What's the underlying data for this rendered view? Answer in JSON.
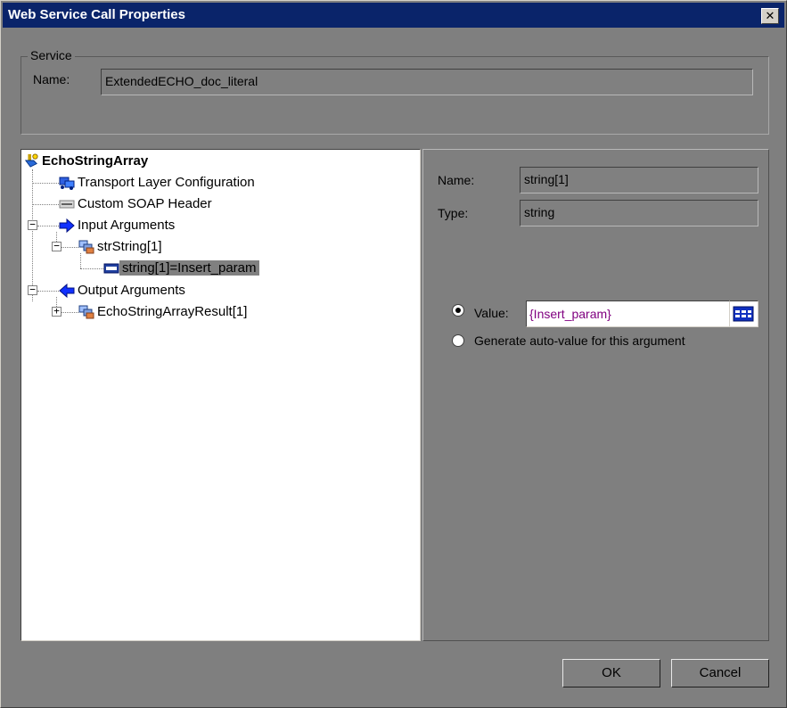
{
  "window": {
    "title": "Web Service Call Properties",
    "close_glyph": "✕"
  },
  "service": {
    "group_label": "Service",
    "name_label": "Name:",
    "name_value": "ExtendedECHO_doc_literal"
  },
  "tree": {
    "root": "EchoStringArray",
    "items": [
      {
        "label": "Transport Layer Configuration",
        "icon": "transport-icon"
      },
      {
        "label": "Custom SOAP Header",
        "icon": "soap-header-icon"
      },
      {
        "label": "Input Arguments",
        "icon": "input-arrow-icon",
        "expander": "−"
      },
      {
        "label": "strString[1]",
        "icon": "complex-type-icon",
        "expander": "−"
      },
      {
        "label": "string[1]=Insert_param",
        "icon": "string-type-icon",
        "selected": true
      },
      {
        "label": "Output Arguments",
        "icon": "output-arrow-icon",
        "expander": "−"
      },
      {
        "label": "EchoStringArrayResult[1]",
        "icon": "complex-type-icon",
        "expander": "+"
      }
    ]
  },
  "properties": {
    "name_label": "Name:",
    "name_value": "string[1]",
    "type_label": "Type:",
    "type_value": "string",
    "value_radio_label": "Value:",
    "value_text": "{Insert_param}",
    "auto_value_label": "Generate auto-value for this argument"
  },
  "buttons": {
    "ok": "OK",
    "cancel": "Cancel"
  },
  "colors": {
    "titlebar": "#0a246a",
    "selection": "#808080",
    "param_text": "#800080"
  }
}
